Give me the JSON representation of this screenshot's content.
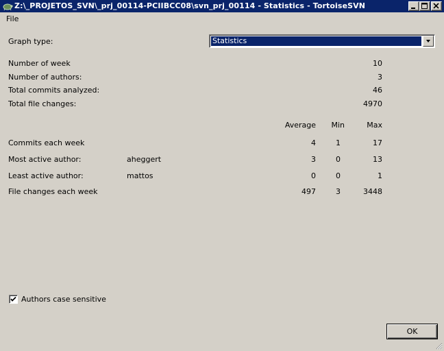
{
  "window": {
    "title": "Z:\\_PROJETOS_SVN\\_prj_00114-PCIIBCC08\\svn_prj_00114 - Statistics - TortoiseSVN"
  },
  "menu": {
    "file": "File"
  },
  "graph_type": {
    "label": "Graph type:",
    "selected": "Statistics"
  },
  "summary": {
    "weeks_label": "Number of week",
    "weeks_value": "10",
    "authors_label": "Number of authors:",
    "authors_value": "3",
    "commits_label": "Total commits analyzed:",
    "commits_value": "46",
    "changes_label": "Total file changes:",
    "changes_value": "4970"
  },
  "table": {
    "headers": {
      "average": "Average",
      "min": "Min",
      "max": "Max"
    },
    "rows": [
      {
        "label": "Commits each week",
        "author": "",
        "average": "4",
        "min": "1",
        "max": "17"
      },
      {
        "label": "Most active author:",
        "author": "aheggert",
        "average": "3",
        "min": "0",
        "max": "13"
      },
      {
        "label": "Least active author:",
        "author": "mattos",
        "average": "0",
        "min": "0",
        "max": "1"
      },
      {
        "label": "File changes each week",
        "author": "",
        "average": "497",
        "min": "3",
        "max": "3448"
      }
    ]
  },
  "options": {
    "case_sensitive_label": "Authors case sensitive",
    "case_sensitive_checked": true
  },
  "buttons": {
    "ok": "OK"
  }
}
